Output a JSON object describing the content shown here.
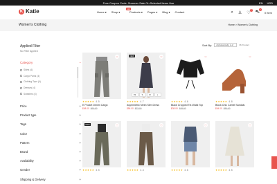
{
  "topbar": {
    "promo": "Free Coupon Code: Summer Sale On Selected Items Use",
    "lang": "EN",
    "currency": "USD"
  },
  "brand": {
    "name": "Katie",
    "initial": "K"
  },
  "nav": {
    "items": [
      "Home",
      "Shop",
      "Products",
      "Pages",
      "Blog",
      "Contact"
    ],
    "hot": "Hot"
  },
  "header": {
    "cart_count": "0",
    "wishlist_count": "0",
    "cart_label": "0 Item"
  },
  "page": {
    "title": "Women's Clothing",
    "breadcrumb": "Home > Women's Clothing"
  },
  "filters": {
    "applied_title": "Applied Filter",
    "no_filter": "No Filter Applied",
    "category_label": "Category",
    "subcategories": [
      "Skirts (4)",
      "Cargo Pants (4)",
      "Clothing Tops (4)",
      "Dresses (4)",
      "Sweaters (4)"
    ],
    "facets": [
      "Price",
      "Product type",
      "Tags",
      "Color",
      "Pattern",
      "Brand",
      "Availability",
      "Gender",
      "Shipping & Delivery"
    ]
  },
  "sort": {
    "label": "Sort By:",
    "selected": "Alphabetically, A-Z",
    "count": "36 Product"
  },
  "products": [
    {
      "name": "E Pocket Denim Cargo",
      "rating": "4.5",
      "price": "$48.00",
      "old_price": "$60.00",
      "tag": "",
      "sizes": []
    },
    {
      "name": "Asymmetric Mesh Slim Dress",
      "rating": "4.7",
      "price": "$56.00",
      "old_price": "$72.00",
      "tag": "NEW",
      "sizes": [
        "XS",
        "S",
        "M",
        "L"
      ]
    },
    {
      "name": "Black Cropped Tie-Waist Top",
      "rating": "4.6",
      "price": "$38.00",
      "old_price": "$45.00",
      "tag": "",
      "sizes": []
    },
    {
      "name": "Block Chic Camel Sandals",
      "rating": "4.8",
      "price": "$64.00",
      "old_price": "$80.00",
      "tag": "",
      "sizes": []
    },
    {
      "name": "",
      "rating": "4.5",
      "price": "",
      "old_price": "",
      "tag": "NEW",
      "sizes": []
    },
    {
      "name": "",
      "rating": "4.4",
      "price": "",
      "old_price": "",
      "tag": "",
      "sizes": []
    },
    {
      "name": "",
      "rating": "4.6",
      "price": "",
      "old_price": "",
      "tag": "",
      "sizes": []
    },
    {
      "name": "",
      "rating": "4.5",
      "price": "",
      "old_price": "",
      "tag": "",
      "sizes": []
    }
  ],
  "colors": {
    "accent": "#e8544e",
    "dark": "#1a1a1a"
  }
}
